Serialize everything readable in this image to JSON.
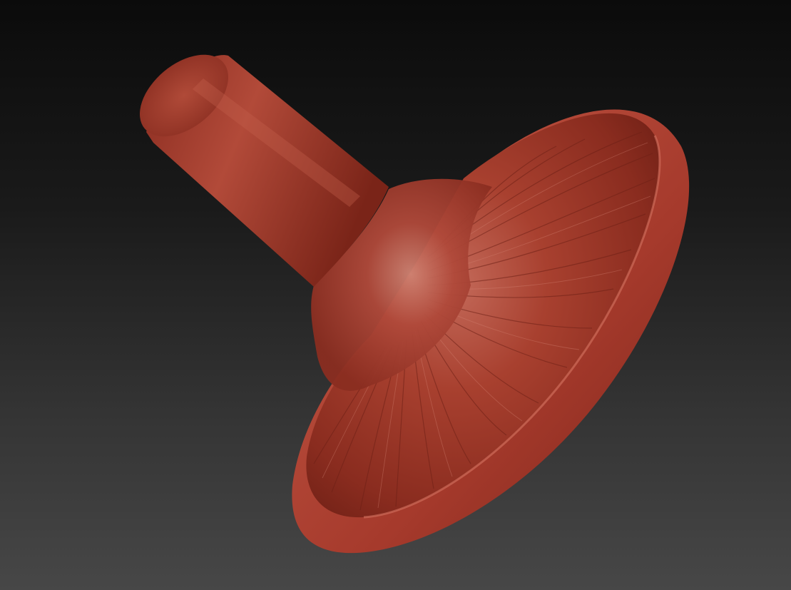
{
  "viewport": {
    "background_top": "#0b0b0b",
    "background_bottom": "#474747"
  },
  "model": {
    "name": "mushroom-sculpt",
    "material_color": "#a63a2c",
    "highlight_color": "#c9705f",
    "shadow_color": "#5e1a12"
  }
}
